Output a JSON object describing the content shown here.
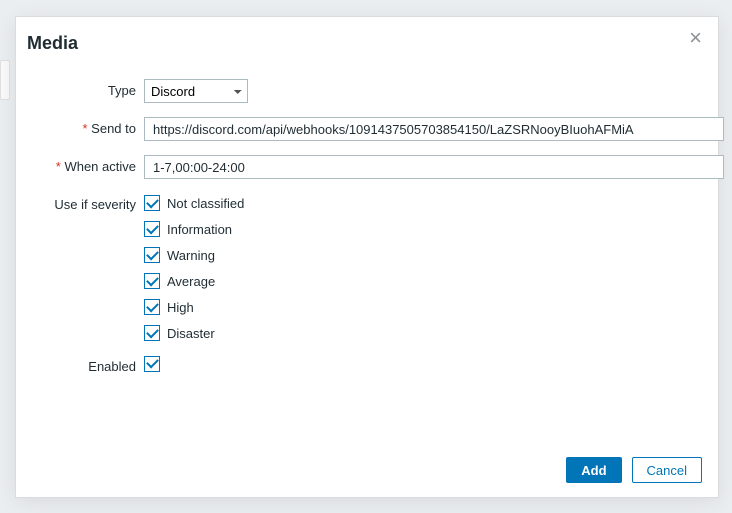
{
  "modal": {
    "title": "Media",
    "labels": {
      "type": "Type",
      "send_to": "Send to",
      "when_active": "When active",
      "use_if_severity": "Use if severity",
      "enabled": "Enabled"
    },
    "type_value": "Discord",
    "send_to_value": "https://discord.com/api/webhooks/1091437505703854150/LaZSRNooyBIuohAFMiA",
    "when_active_value": "1-7,00:00-24:00",
    "severities": [
      {
        "label": "Not classified",
        "checked": true
      },
      {
        "label": "Information",
        "checked": true
      },
      {
        "label": "Warning",
        "checked": true
      },
      {
        "label": "Average",
        "checked": true
      },
      {
        "label": "High",
        "checked": true
      },
      {
        "label": "Disaster",
        "checked": true
      }
    ],
    "enabled_checked": true,
    "buttons": {
      "add": "Add",
      "cancel": "Cancel"
    }
  }
}
